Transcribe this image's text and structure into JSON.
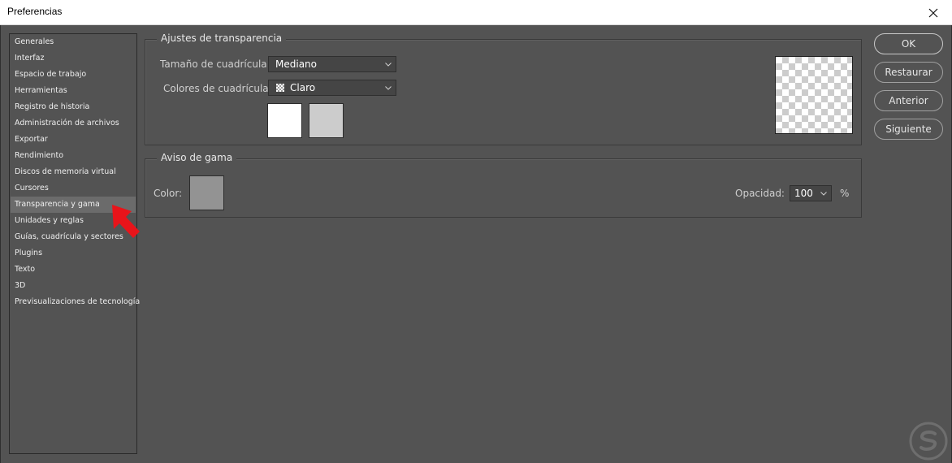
{
  "window": {
    "title": "Preferencias"
  },
  "sidebar": {
    "items": [
      {
        "label": "Generales"
      },
      {
        "label": "Interfaz"
      },
      {
        "label": "Espacio de trabajo"
      },
      {
        "label": "Herramientas"
      },
      {
        "label": "Registro de historia"
      },
      {
        "label": "Administración de archivos"
      },
      {
        "label": "Exportar"
      },
      {
        "label": "Rendimiento"
      },
      {
        "label": "Discos de memoria virtual"
      },
      {
        "label": "Cursores"
      },
      {
        "label": "Transparencia y gama"
      },
      {
        "label": "Unidades y reglas"
      },
      {
        "label": "Guías, cuadrícula y sectores"
      },
      {
        "label": "Plugins"
      },
      {
        "label": "Texto"
      },
      {
        "label": "3D"
      },
      {
        "label": "Previsualizaciones de tecnología"
      }
    ],
    "selected": "Transparencia y gama"
  },
  "transparency": {
    "legend": "Ajustes de transparencia",
    "grid_size_label": "Tamaño de cuadrícula:",
    "grid_size_value": "Mediano",
    "grid_colors_label": "Colores de cuadrícula:",
    "grid_colors_value": "Claro",
    "color1": "#ffffff",
    "color2": "#cccccc"
  },
  "gamut": {
    "legend": "Aviso de gama",
    "color_label": "Color:",
    "color_value": "#939393",
    "opacity_label": "Opacidad:",
    "opacity_value": "100",
    "opacity_unit": "%"
  },
  "buttons": {
    "ok": "OK",
    "restore": "Restaurar",
    "previous": "Anterior",
    "next": "Siguiente"
  },
  "colors": {
    "background": "#535353",
    "selected_item": "#6b6b6b",
    "annotation_arrow": "#e8141a"
  }
}
